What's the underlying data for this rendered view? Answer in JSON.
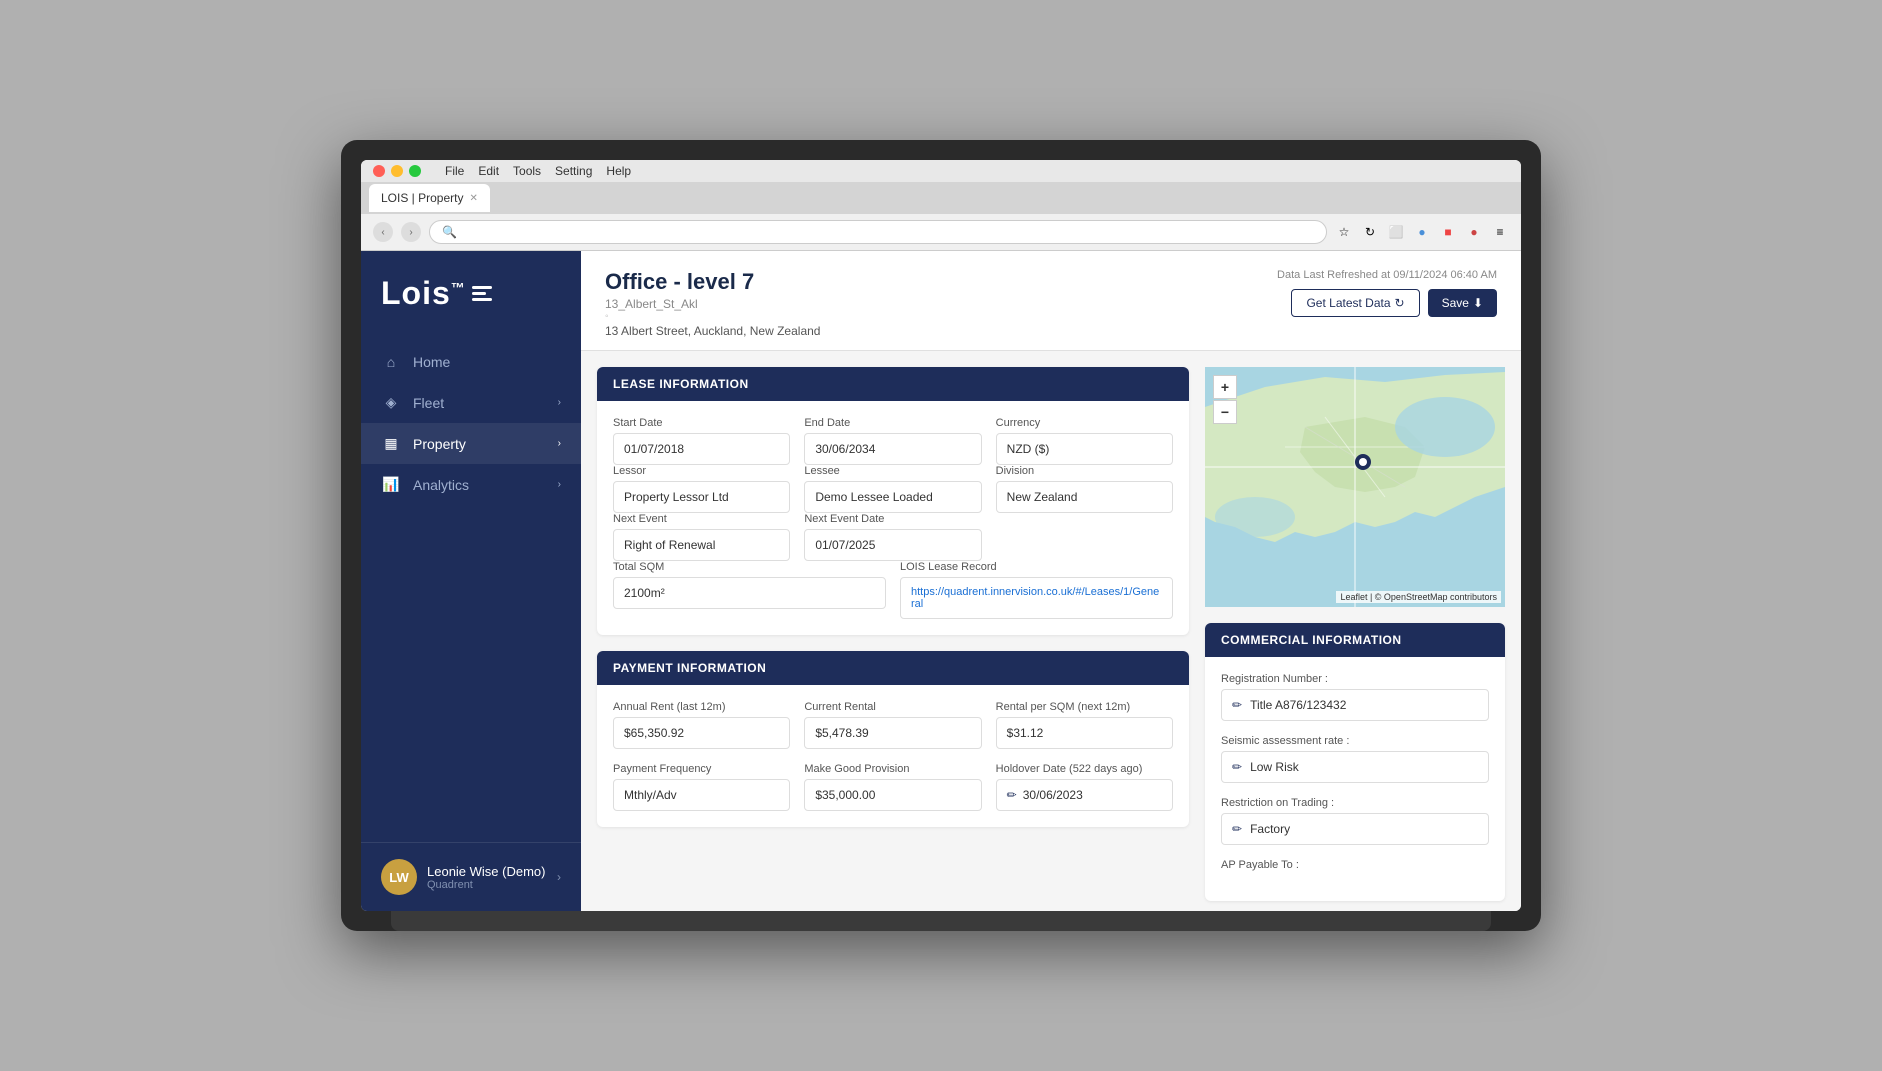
{
  "browser": {
    "tab_title": "LOIS | Property",
    "menu_items": [
      "File",
      "Edit",
      "Tools",
      "Setting",
      "Help"
    ]
  },
  "sidebar": {
    "logo": "Lois",
    "logo_tm": "™",
    "nav_items": [
      {
        "id": "home",
        "label": "Home",
        "icon": "home",
        "has_chevron": false
      },
      {
        "id": "fleet",
        "label": "Fleet",
        "icon": "fleet",
        "has_chevron": true
      },
      {
        "id": "property",
        "label": "Property",
        "icon": "property",
        "has_chevron": true,
        "active": true
      },
      {
        "id": "analytics",
        "label": "Analytics",
        "icon": "analytics",
        "has_chevron": true
      }
    ],
    "user": {
      "initials": "LW",
      "name": "Leonie Wise (Demo)",
      "company": "Quadrent"
    }
  },
  "property": {
    "title": "Office - level 7",
    "subtitle": "13_Albert_St_Akl",
    "address": "13 Albert Street, Auckland, New Zealand",
    "data_refreshed": "Data Last Refreshed at 09/11/2024 06:40 AM",
    "btn_get_latest": "Get Latest Data",
    "btn_save": "Save"
  },
  "lease_info": {
    "section_title": "LEASE INFORMATION",
    "start_date_label": "Start Date",
    "start_date_value": "01/07/2018",
    "end_date_label": "End Date",
    "end_date_value": "30/06/2034",
    "currency_label": "Currency",
    "currency_value": "NZD ($)",
    "lessor_label": "Lessor",
    "lessor_value": "Property Lessor Ltd",
    "lessee_label": "Lessee",
    "lessee_value": "Demo Lessee Loaded",
    "division_label": "Division",
    "division_value": "New Zealand",
    "next_event_label": "Next Event",
    "next_event_value": "Right of Renewal",
    "next_event_date_label": "Next Event Date",
    "next_event_date_value": "01/07/2025",
    "total_sqm_label": "Total SQM",
    "total_sqm_value": "2100m²",
    "lois_record_label": "LOIS Lease Record",
    "lois_record_value": "https://quadrent.innervision.co.uk/#/Leases/1/General"
  },
  "payment_info": {
    "section_title": "PAYMENT INFORMATION",
    "annual_rent_label": "Annual Rent (last 12m)",
    "annual_rent_value": "$65,350.92",
    "current_rental_label": "Current Rental",
    "current_rental_value": "$5,478.39",
    "rental_sqm_label": "Rental per SQM (next 12m)",
    "rental_sqm_value": "$31.12",
    "payment_freq_label": "Payment Frequency",
    "payment_freq_value": "Mthly/Adv",
    "make_good_label": "Make Good Provision",
    "make_good_value": "$35,000.00",
    "holdover_label": "Holdover Date (522 days ago)",
    "holdover_value": "30/06/2023"
  },
  "commercial_info": {
    "section_title": "COMMERCIAL INFORMATION",
    "registration_label": "Registration Number :",
    "registration_value": "Title A876/123432",
    "seismic_label": "Seismic assessment rate :",
    "seismic_value": "Low Risk",
    "restriction_label": "Restriction on Trading :",
    "restriction_value": "Factory",
    "ap_payable_label": "AP Payable To :"
  },
  "map": {
    "zoom_in": "+",
    "zoom_out": "−",
    "attribution": "Leaflet | © OpenStreetMap contributors"
  },
  "colors": {
    "sidebar_bg": "#1e2d5a",
    "header_bg": "#1e2d5a",
    "accent": "#1a6fd4"
  }
}
